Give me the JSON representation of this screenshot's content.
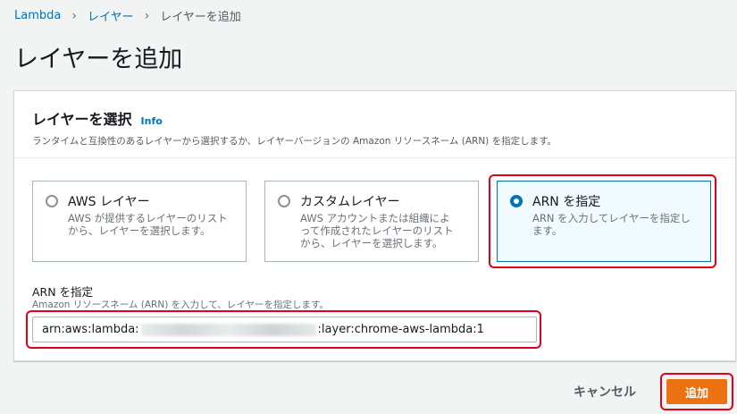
{
  "breadcrumb": {
    "items": [
      "Lambda",
      "レイヤー"
    ],
    "current": "レイヤーを追加",
    "separator": ">"
  },
  "page_title": "レイヤーを追加",
  "panel": {
    "title": "レイヤーを選択",
    "info": "Info",
    "description": "ランタイムと互換性のあるレイヤーから選択するか、レイヤーバージョンの Amazon リソースネーム (ARN) を指定します。"
  },
  "options": [
    {
      "title": "AWS レイヤー",
      "desc1": "AWS が提供するレイヤーのリスト",
      "desc2": "から、レイヤーを選択します。",
      "desc3": "",
      "selected": false
    },
    {
      "title": "カスタムレイヤー",
      "desc1": "AWS アカウントまたは組織によ",
      "desc2": "って作成されたレイヤーのリスト",
      "desc3": "から、レイヤーを選択します。",
      "selected": false
    },
    {
      "title": "ARN を指定",
      "desc1": "ARN を入力してレイヤーを指定し",
      "desc2": "ます。",
      "desc3": "",
      "selected": true
    }
  ],
  "arn_field": {
    "label": "ARN を指定",
    "description": "Amazon リソースネーム (ARN) を入力して、レイヤーを指定します。",
    "value_prefix": "arn:aws:lambda:",
    "value_suffix": ":layer:chrome-aws-lambda:1"
  },
  "buttons": {
    "cancel": "キャンセル",
    "add": "追加"
  },
  "colors": {
    "accent": "#0073bb",
    "primary_button": "#ec7211",
    "highlight": "#e0001b"
  }
}
